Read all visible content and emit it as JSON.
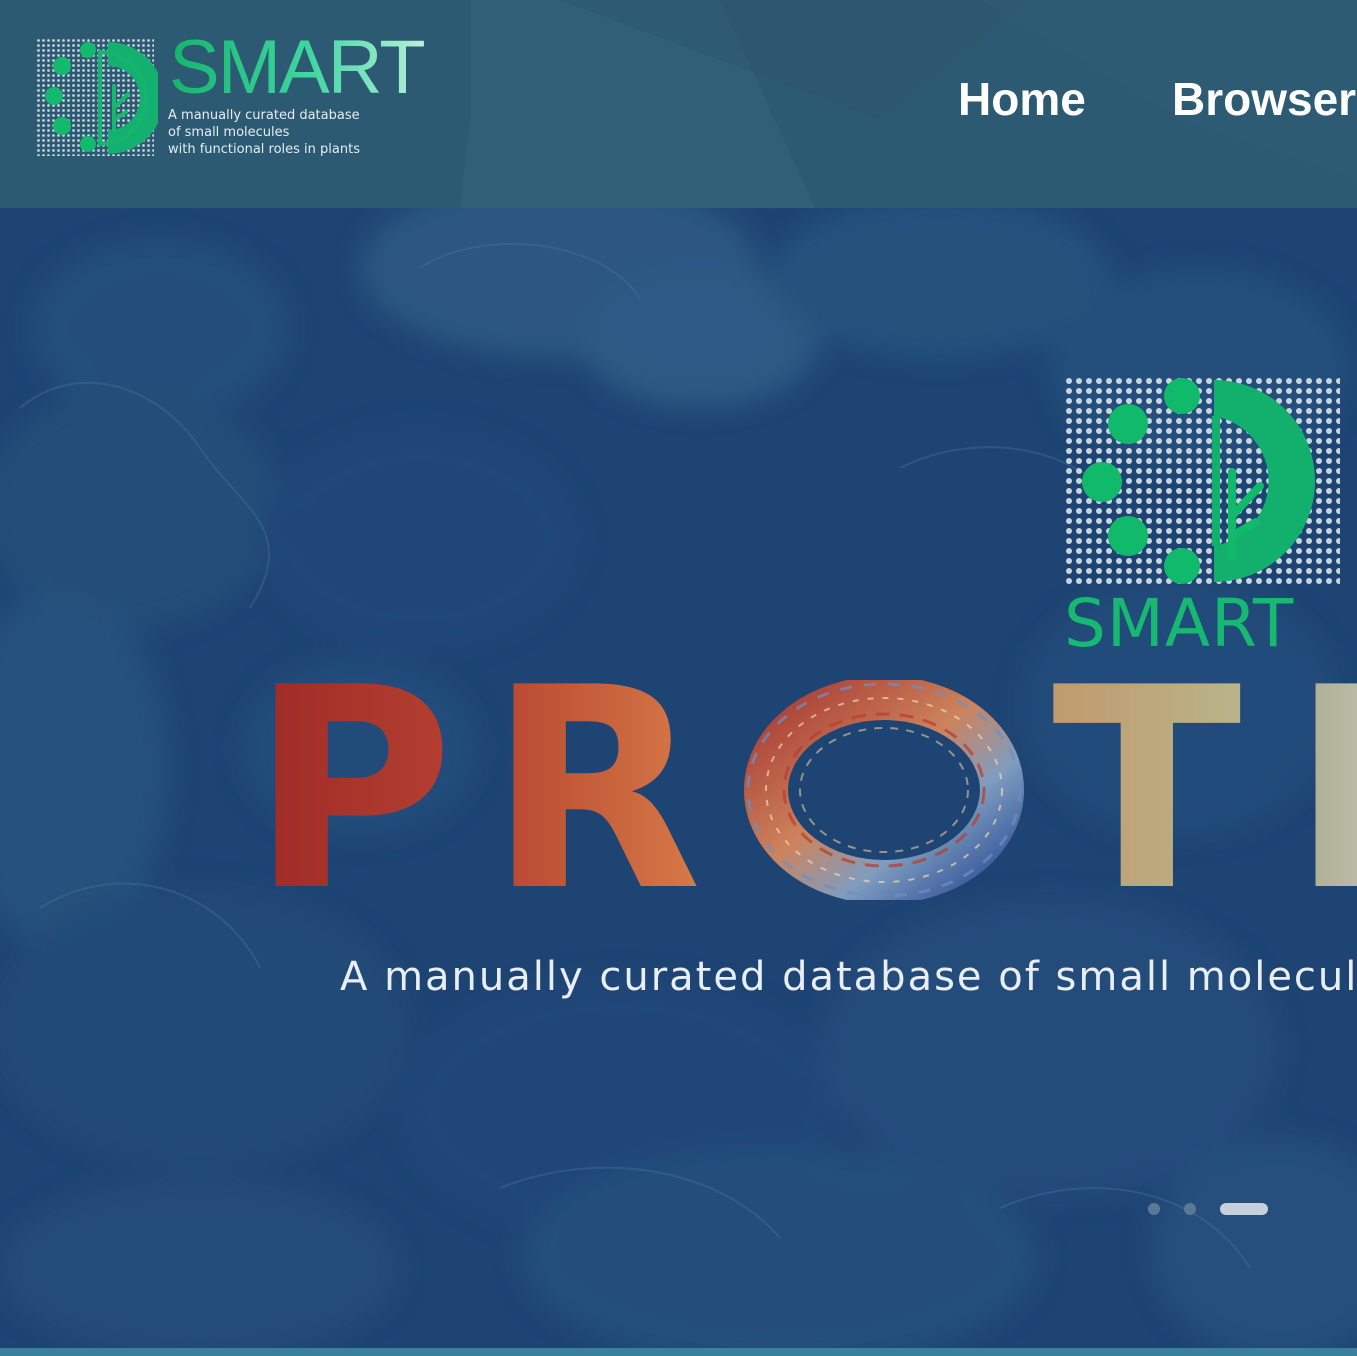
{
  "header": {
    "brand": {
      "name": "SMART",
      "tagline": [
        "A manually curated database",
        "of small molecules",
        "with functional roles in plants"
      ],
      "icon": "smart-leaf-dots-logo"
    },
    "nav": {
      "items": [
        {
          "label": "Home"
        },
        {
          "label": "Browser"
        }
      ]
    }
  },
  "hero": {
    "slide_logo_name": "SMART",
    "headline_letters": [
      "P",
      "R",
      "T",
      "I"
    ],
    "headline_colors": [
      "#a9302a",
      "#d06a42",
      "#c8a676",
      "#b0b498"
    ],
    "caption": "A manually curated database of small molecul",
    "carousel": {
      "slide_count": 3,
      "active_index": 2
    }
  },
  "colors": {
    "header_bg": "#2d5a73",
    "hero_bg": "#1c4372",
    "brand_green": "#17b872",
    "nav_text": "#ffffff"
  }
}
